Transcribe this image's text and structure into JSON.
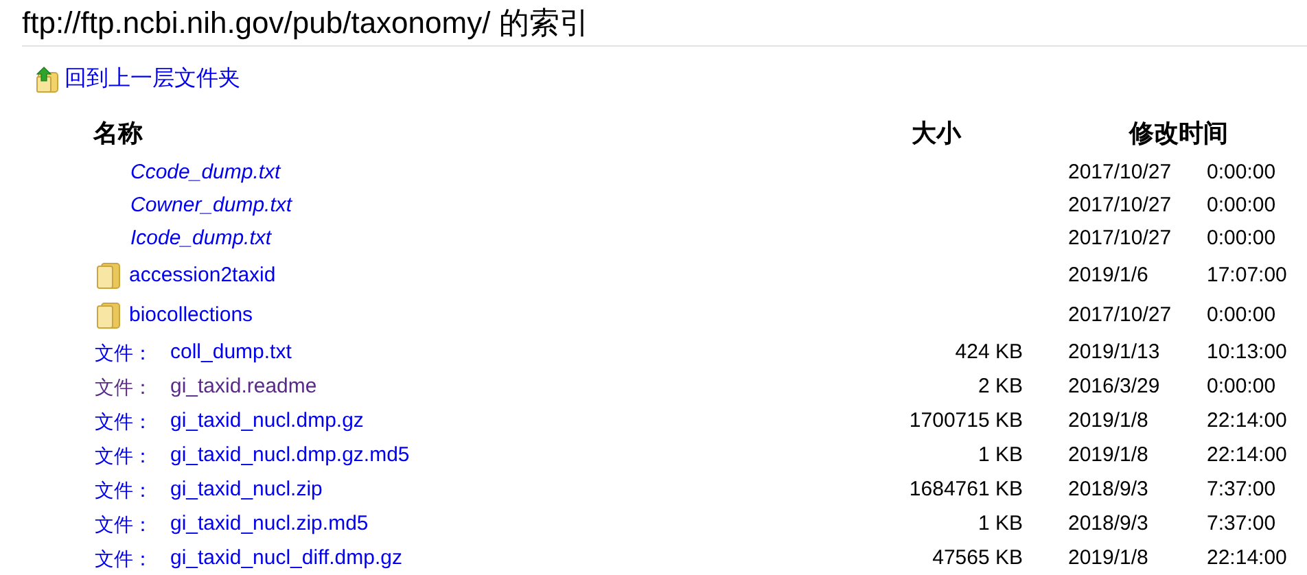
{
  "title": "ftp://ftp.ncbi.nih.gov/pub/taxonomy/ 的索引",
  "parent_link": "回到上一层文件夹",
  "columns": [
    "名称",
    "大小",
    "修改时间"
  ],
  "rows": [
    {
      "kind": "symlink",
      "name": "Ccode_dump.txt",
      "date": "2017/10/27",
      "time": "0:00:00",
      "visited": false
    },
    {
      "kind": "symlink",
      "name": "Cowner_dump.txt",
      "date": "2017/10/27",
      "time": "0:00:00",
      "visited": false
    },
    {
      "kind": "symlink",
      "name": "Icode_dump.txt",
      "date": "2017/10/27",
      "time": "0:00:00",
      "visited": false
    },
    {
      "kind": "folder",
      "name": "accession2taxid",
      "date": "2019/1/6",
      "time": "17:07:00",
      "visited": false
    },
    {
      "kind": "folder",
      "name": "biocollections",
      "date": "2017/10/27",
      "time": "0:00:00",
      "visited": false
    },
    {
      "kind": "file",
      "label": "文件：",
      "name": "coll_dump.txt",
      "size": "424 KB",
      "date": "2019/1/13",
      "time": "10:13:00",
      "visited": false
    },
    {
      "kind": "file",
      "label": "文件：",
      "name": "gi_taxid.readme",
      "size": "2 KB",
      "date": "2016/3/29",
      "time": "0:00:00",
      "visited": true
    },
    {
      "kind": "file",
      "label": "文件：",
      "name": "gi_taxid_nucl.dmp.gz",
      "size": "1700715 KB",
      "date": "2019/1/8",
      "time": "22:14:00",
      "visited": false
    },
    {
      "kind": "file",
      "label": "文件：",
      "name": "gi_taxid_nucl.dmp.gz.md5",
      "size": "1 KB",
      "date": "2019/1/8",
      "time": "22:14:00",
      "visited": false
    },
    {
      "kind": "file",
      "label": "文件：",
      "name": "gi_taxid_nucl.zip",
      "size": "1684761 KB",
      "date": "2018/9/3",
      "time": "7:37:00",
      "visited": false
    },
    {
      "kind": "file",
      "label": "文件：",
      "name": "gi_taxid_nucl.zip.md5",
      "size": "1 KB",
      "date": "2018/9/3",
      "time": "7:37:00",
      "visited": false
    },
    {
      "kind": "file",
      "label": "文件：",
      "name": "gi_taxid_nucl_diff.dmp.gz",
      "size": "47565 KB",
      "date": "2019/1/8",
      "time": "22:14:00",
      "visited": false
    }
  ]
}
